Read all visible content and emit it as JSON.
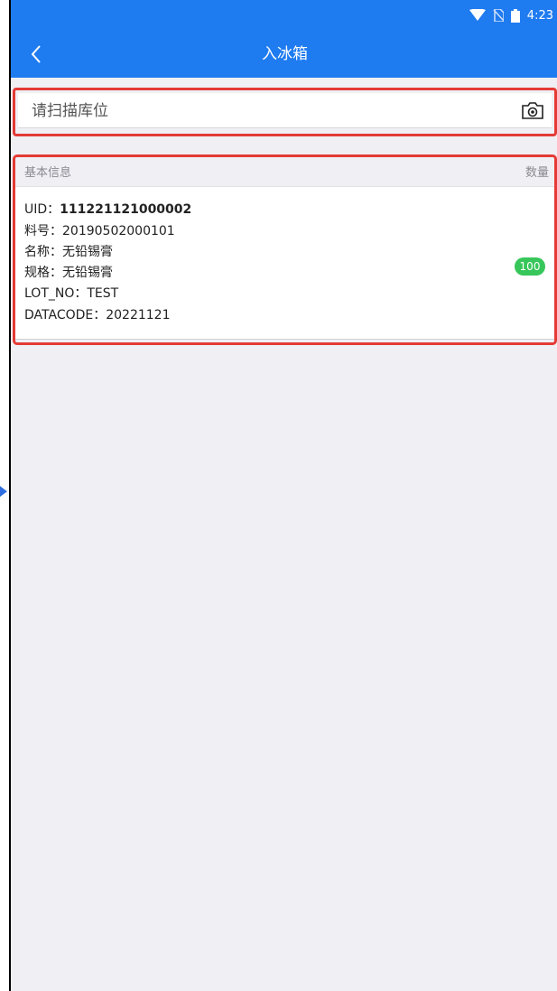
{
  "status_bar": {
    "time": "4:23",
    "icons": [
      "wifi-icon",
      "no-sim-icon",
      "battery-icon"
    ]
  },
  "navbar": {
    "title": "入冰箱",
    "back_icon": "chevron-left-icon",
    "color": "#1f7bf0"
  },
  "scan": {
    "placeholder": "请扫描库位",
    "icon": "camera-icon"
  },
  "info": {
    "header_left": "基本信息",
    "header_right": "数量",
    "item": {
      "uid_label": "UID：",
      "uid_value": "111221121000002",
      "part_no": "料号：20190502000101",
      "name": "名称：无铅锡膏",
      "spec": "规格：无铅锡膏",
      "lot_no": "LOT_NO：TEST",
      "datacode": "DATACODE：20221121",
      "quantity": "100"
    }
  },
  "colors": {
    "highlight_border": "#e43a35",
    "badge": "#37c65a",
    "background": "#efeff4"
  }
}
